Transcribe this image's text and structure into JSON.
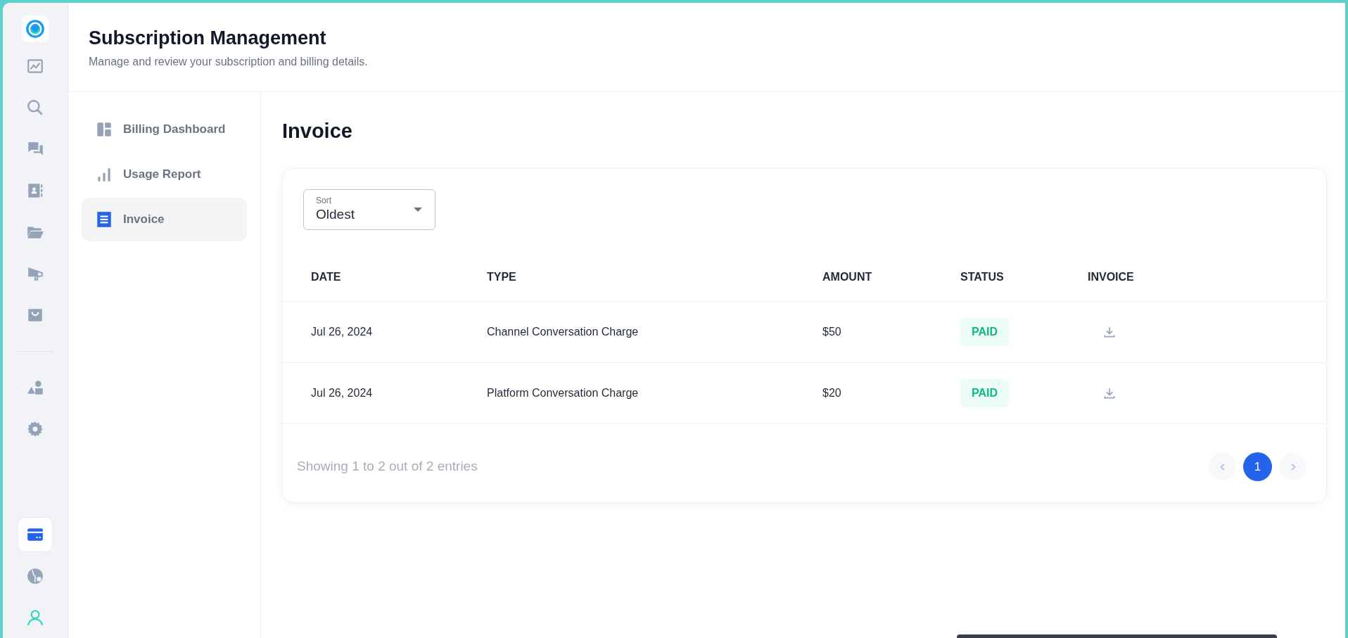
{
  "rail": {
    "top_items": [
      {
        "selected": false
      },
      {
        "selected": false
      },
      {
        "selected": false
      },
      {
        "selected": false
      },
      {
        "selected": false
      },
      {
        "selected": false
      },
      {
        "selected": false
      }
    ],
    "middle_items": [
      {
        "selected": false
      },
      {
        "selected": false
      }
    ],
    "bottom_items": [
      {
        "selected": true
      },
      {
        "selected": false
      },
      {
        "selected": false
      }
    ]
  },
  "header": {
    "title": "Subscription Management",
    "subtitle": "Manage and review your subscription and billing details."
  },
  "subnav": [
    {
      "label": "Billing Dashboard",
      "selected": false
    },
    {
      "label": "Usage Report",
      "selected": false
    },
    {
      "label": "Invoice",
      "selected": true
    }
  ],
  "page_title": "Invoice",
  "sort": {
    "label": "Sort",
    "value": "Oldest"
  },
  "table": {
    "columns": [
      "DATE",
      "TYPE",
      "AMOUNT",
      "STATUS",
      "INVOICE"
    ],
    "rows": [
      {
        "date": "Jul 26, 2024",
        "type": "Channel Conversation Charge",
        "amount": "$50",
        "status": "PAID"
      },
      {
        "date": "Jul 26, 2024",
        "type": "Platform Conversation Charge",
        "amount": "$20",
        "status": "PAID"
      }
    ]
  },
  "footer": {
    "summary": "Showing 1 to 2 out of 2 entries",
    "pages": [
      {
        "label": "1",
        "selected": true
      }
    ],
    "prev_disabled": true,
    "next_disabled": true
  }
}
